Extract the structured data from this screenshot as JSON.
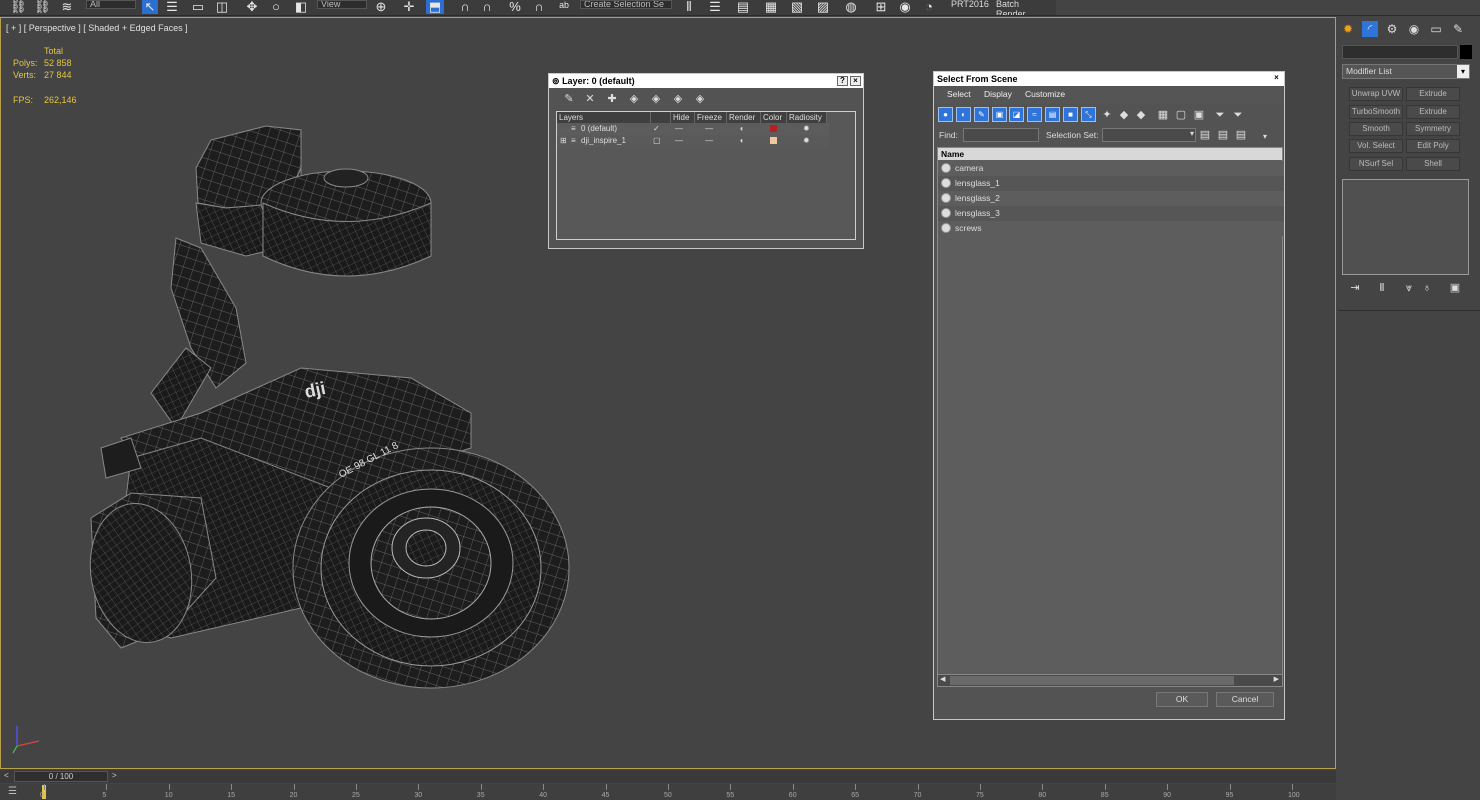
{
  "toolbar": {
    "selection_filter": "All",
    "view_dropdown": "View",
    "named_selection": "Create Selection Se",
    "prt_label": "PRT2016",
    "batch_render": "Batch Render..."
  },
  "viewport": {
    "label": "[ + ] [ Perspective ] [ Shaded + Edged Faces ]",
    "stats": {
      "total_label": "Total",
      "polys_label": "Polys:",
      "polys_value": "52 858",
      "verts_label": "Verts:",
      "verts_value": "27 844",
      "fps_label": "FPS:",
      "fps_value": "262,146"
    }
  },
  "layer_dialog": {
    "title": "Layer: 0 (default)",
    "help": "?",
    "close": "×",
    "columns": [
      "Layers",
      "Hide",
      "Freeze",
      "Render",
      "Color",
      "Radiosity"
    ],
    "rows": [
      {
        "name": "0 (default)",
        "color": "#b22222"
      },
      {
        "name": "dji_inspire_1",
        "color": "#f0c8a0"
      }
    ]
  },
  "select_dialog": {
    "title": "Select From Scene",
    "close": "×",
    "menus": [
      "Select",
      "Display",
      "Customize"
    ],
    "find_label": "Find:",
    "find_value": "",
    "selection_set_label": "Selection Set:",
    "selection_set_value": "",
    "name_header": "Name",
    "items": [
      "camera",
      "lensglass_1",
      "lensglass_2",
      "lensglass_3",
      "screws"
    ],
    "ok": "OK",
    "cancel": "Cancel"
  },
  "command_panel": {
    "object_name": "",
    "modifier_list": "Modifier List",
    "buttons": [
      [
        "Unwrap UVW",
        "Extrude"
      ],
      [
        "TurboSmooth",
        "Extrude"
      ],
      [
        "Smooth",
        "Symmetry"
      ],
      [
        "Vol. Select",
        "Edit Poly"
      ],
      [
        "NSurf Sel",
        "Shell"
      ]
    ]
  },
  "timeline": {
    "frame": "0 / 100",
    "prev": "<",
    "next": ">",
    "ticks": [
      "0",
      "5",
      "10",
      "15",
      "20",
      "25",
      "30",
      "35",
      "40",
      "45",
      "50",
      "55",
      "60",
      "65",
      "70",
      "75",
      "80",
      "85",
      "90",
      "95",
      "100"
    ]
  }
}
